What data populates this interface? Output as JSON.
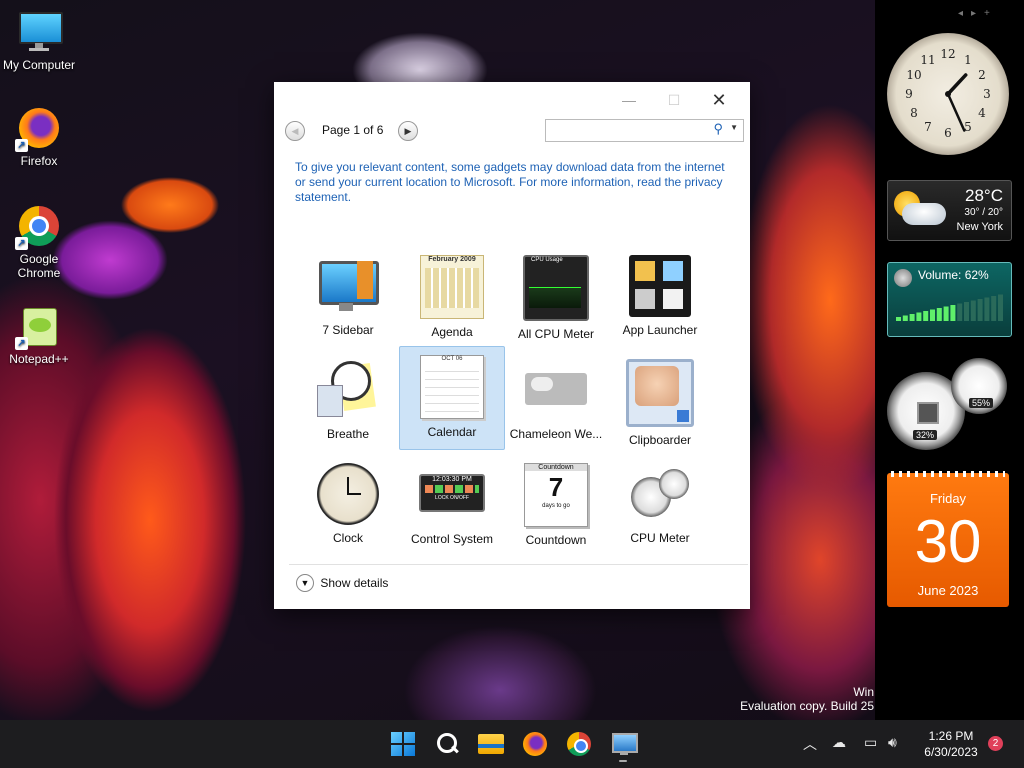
{
  "desktop": {
    "icons": [
      {
        "label": "My Computer"
      },
      {
        "label": "Firefox"
      },
      {
        "label": "Google Chrome"
      },
      {
        "label": "Notepad++"
      }
    ],
    "watermark_line1": "Win",
    "watermark_line2": "Evaluation copy. Build 25"
  },
  "sidebar_gadgets": {
    "weather": {
      "temp": "28°C",
      "range": "30° / 20°",
      "city": "New York"
    },
    "volume": {
      "label": "Volume: 62%",
      "level_percent": 62
    },
    "cpu_meter": {
      "cpu": "32%",
      "memory": "55%"
    },
    "calendar": {
      "weekday": "Friday",
      "day": "30",
      "month_year": "June 2023"
    },
    "clock": {
      "hour": 1,
      "minute": 26
    }
  },
  "dialog": {
    "page_label": "Page 1 of 6",
    "search_placeholder": "",
    "notice": "To give you relevant content, some gadgets may download data from the internet or send your current location to Microsoft. For more information, read the privacy statement.",
    "gadgets": [
      {
        "label": "7 Sidebar"
      },
      {
        "label": "Agenda"
      },
      {
        "label": "All CPU Meter"
      },
      {
        "label": "App Launcher"
      },
      {
        "label": "Breathe"
      },
      {
        "label": "Calendar",
        "selected": true
      },
      {
        "label": "Chameleon We..."
      },
      {
        "label": "Clipboarder"
      },
      {
        "label": "Clock"
      },
      {
        "label": "Control System"
      },
      {
        "label": "Countdown"
      },
      {
        "label": "CPU Meter"
      }
    ],
    "show_details": "Show details",
    "tile_texts": {
      "agenda_month": "February 2009",
      "cpu_title": "CPU Usage",
      "cal_month": "OCT 06",
      "control_time": "12:03:30 PM",
      "control_lock": "LOCK ON/OFF",
      "countdown_title": "Countdown",
      "countdown_num": "7",
      "countdown_sub": "days to go"
    }
  },
  "taskbar": {
    "time": "1:26 PM",
    "date": "6/30/2023",
    "notification_count": "2"
  }
}
